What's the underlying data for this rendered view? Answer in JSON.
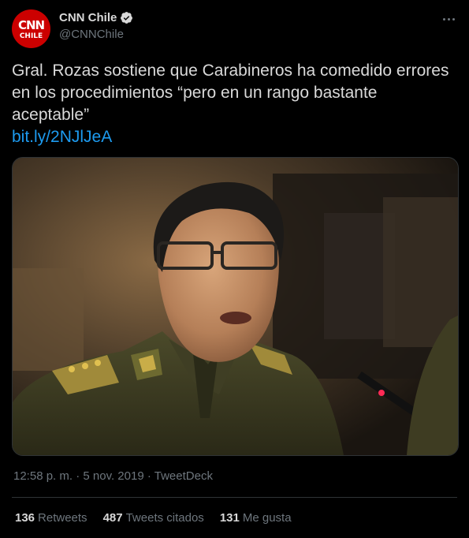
{
  "author": {
    "name": "CNN Chile",
    "handle": "@CNNChile",
    "avatar_top": "CNN",
    "avatar_bottom": "CHILE",
    "brand_color": "#cc0000",
    "verified_icon": "verified-badge-icon"
  },
  "tweet": {
    "text": "Gral. Rozas sostiene que Carabineros ha comedido errores en los procedimientos “pero en un rango bastante aceptable”",
    "link": "bit.ly/2NJlJeA",
    "link_color": "#1d9bf0"
  },
  "meta": {
    "time": "12:58 p. m.",
    "separator": "·",
    "date": "5 nov. 2019",
    "source": "TweetDeck"
  },
  "stats": [
    {
      "count": "136",
      "label": "Retweets"
    },
    {
      "count": "487",
      "label": "Tweets citados"
    },
    {
      "count": "131",
      "label": "Me gusta"
    }
  ],
  "colors": {
    "background": "#000000",
    "text": "#d9d9d9",
    "muted": "#6e767d",
    "border": "#2f3336"
  }
}
